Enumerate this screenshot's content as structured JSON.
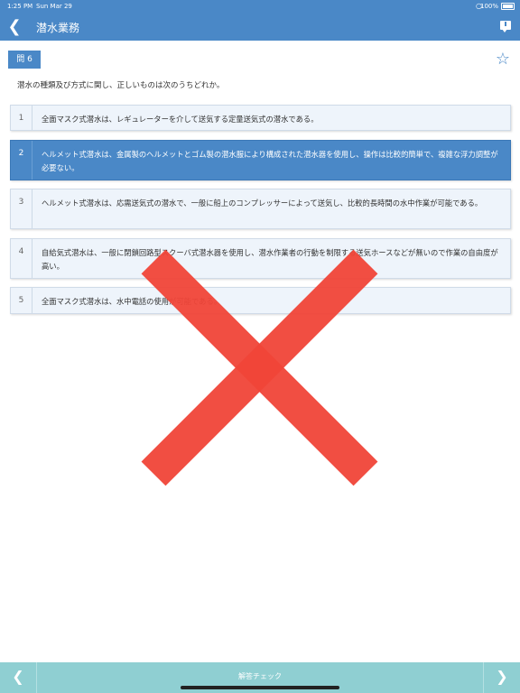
{
  "status_bar": {
    "time": "1:25 PM",
    "date": "Sun Mar 29",
    "battery": "100%"
  },
  "nav": {
    "title": "潜水業務"
  },
  "question": {
    "badge": "問 6",
    "text": "潜水の種類及び方式に関し、正しいものは次のうちどれか。"
  },
  "choices": [
    {
      "num": "1",
      "text": "全面マスク式潜水は、レギュレーターを介して送気する定量送気式の潜水である。",
      "selected": false
    },
    {
      "num": "2",
      "text": "ヘルメット式潜水は、金属製のヘルメットとゴム製の潜水服により構成された潜水器を使用し、操作は比較的簡単で、複雑な浮力調整が必要ない。",
      "selected": true
    },
    {
      "num": "3",
      "text": "ヘルメット式潜水は、応需送気式の潜水で、一般に船上のコンプレッサーによって送気し、比較的長時間の水中作業が可能である。",
      "selected": false
    },
    {
      "num": "4",
      "text": "自給気式潜水は、一般に閉鎖回路型スクーバ式潜水器を使用し、潜水作業者の行動を制限する送気ホースなどが無いので作業の自由度が高い。",
      "selected": false
    },
    {
      "num": "5",
      "text": "全面マスク式潜水は、水中電話の使用が可能である。",
      "selected": false
    }
  ],
  "result": {
    "mark": "incorrect",
    "color": "#f04438"
  },
  "bottom": {
    "check_label": "解答チェック"
  },
  "colors": {
    "accent": "#4a88c7",
    "bottom_bar": "#8fcfd2"
  },
  "icons": {
    "back": "chevron-left-icon",
    "comment": "comment-icon",
    "star": "star-outline-icon"
  }
}
